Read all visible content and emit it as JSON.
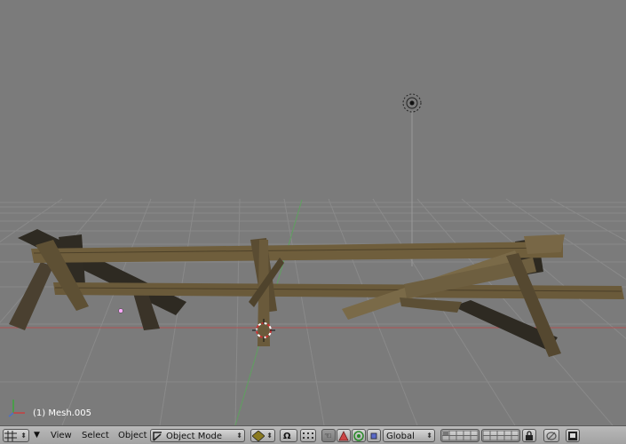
{
  "viewport": {
    "object_info": "(1) Mesh.005"
  },
  "header": {
    "menus": [
      "View",
      "Select",
      "Object"
    ],
    "mode_selector": {
      "label": "Object Mode"
    },
    "orientation_selector": {
      "label": "Global"
    }
  },
  "colors": {
    "viewport_bg": "#7b7b7b",
    "grid_line": "#8a8a8a",
    "x_axis": "#b05252",
    "y_axis": "#5fa05f",
    "wood": "#6f5e3c"
  }
}
